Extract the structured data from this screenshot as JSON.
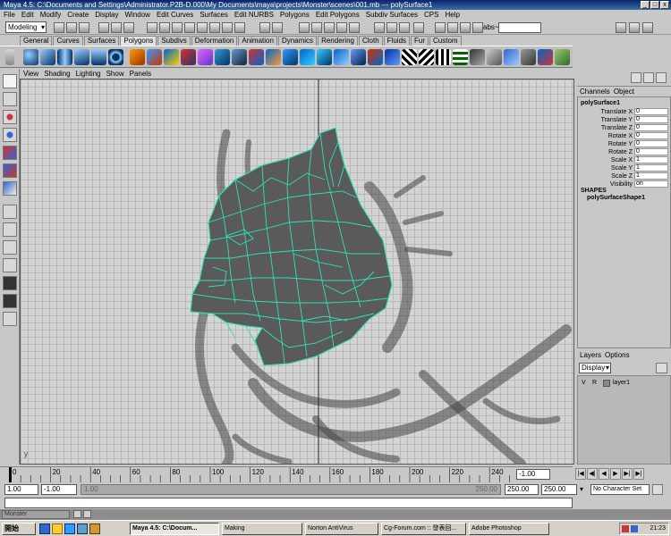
{
  "window": {
    "title": "Maya 4.5: C:\\Documents and Settings\\Administrator.P2B-D.000\\My Documents\\maya\\projects\\Monster\\scenes\\001.mb   ---   polySurface1",
    "controls": [
      "_",
      "□",
      "x"
    ]
  },
  "menubar": [
    "File",
    "Edit",
    "Modify",
    "Create",
    "Display",
    "Window",
    "Edit Curves",
    "Surfaces",
    "Edit NURBS",
    "Polygons",
    "Edit Polygons",
    "Subdiv Surfaces",
    "CPS",
    "Help"
  ],
  "statusline": {
    "mode": "Modeling",
    "abs_label": "abs~",
    "abs_value": ""
  },
  "shelf": {
    "tabs": [
      "General",
      "Curves",
      "Surfaces",
      "Polygons",
      "Subdivs",
      "Deformation",
      "Animation",
      "Dynamics",
      "Rendering",
      "Cloth",
      "Fluids",
      "Fur",
      "Custom"
    ],
    "active_tab": "Polygons"
  },
  "viewport": {
    "menu": [
      "View",
      "Shading",
      "Lighting",
      "Show",
      "Panels"
    ],
    "axis_label": "y",
    "wire_color": "#2fe0b8",
    "mesh_color": "#5a5a5a"
  },
  "channelbox": {
    "menu": [
      "Channels",
      "Object"
    ],
    "object_name": "polySurface1",
    "attributes": [
      {
        "label": "Translate X",
        "value": "0"
      },
      {
        "label": "Translate Y",
        "value": "0"
      },
      {
        "label": "Translate Z",
        "value": "0"
      },
      {
        "label": "Rotate X",
        "value": "0"
      },
      {
        "label": "Rotate Y",
        "value": "0"
      },
      {
        "label": "Rotate Z",
        "value": "0"
      },
      {
        "label": "Scale X",
        "value": "1"
      },
      {
        "label": "Scale Y",
        "value": "1"
      },
      {
        "label": "Scale Z",
        "value": "1"
      },
      {
        "label": "Visibility",
        "value": "on"
      }
    ],
    "shapes_heading": "SHAPES",
    "shape_name": "polySurfaceShape1"
  },
  "layers": {
    "menu": [
      "Layers",
      "Options"
    ],
    "display_mode": "Display",
    "layer": {
      "v": "V",
      "r": "R",
      "name": "layer1"
    }
  },
  "timeslider": {
    "tick_labels": [
      "0",
      "20",
      "40",
      "60",
      "80",
      "100",
      "120",
      "140",
      "160",
      "180",
      "200",
      "220",
      "240"
    ],
    "current_time": "-1.00",
    "playback_buttons": [
      "|◀",
      "◀|",
      "◀",
      "▶",
      "▶|",
      "▶|"
    ]
  },
  "rangeslider": {
    "start_time": "1.00",
    "playback_start": "-1.00",
    "range_start_label": "1.00",
    "range_end_label": "250.00",
    "playback_end": "250.00",
    "end_time": "250.00",
    "character_set": "No Character Set"
  },
  "helpline": {
    "minimized_title": "Monster"
  },
  "taskbar": {
    "start": "開始",
    "tasks": [
      {
        "label": "Maya 4.5: C:\\Docum...",
        "active": true
      },
      {
        "label": "Making",
        "active": false
      },
      {
        "label": "Norton AntiVirus",
        "active": false
      },
      {
        "label": "Cg-Forum.com :: 發表回...",
        "active": false
      },
      {
        "label": "Adobe Photoshop",
        "active": false
      }
    ],
    "clock": "21:23"
  }
}
